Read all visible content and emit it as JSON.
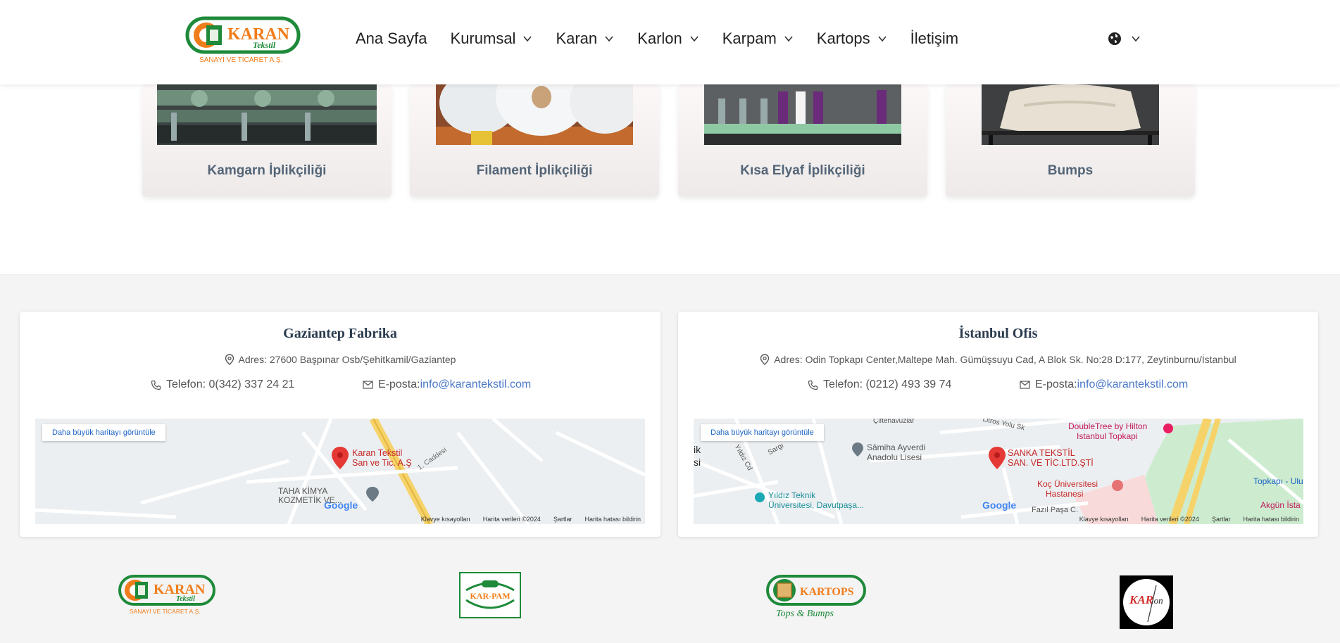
{
  "header": {
    "logo": {
      "name": "KARAN",
      "sub": "Tekstil",
      "tagline": "SANAYİ VE TİCARET A.Ş."
    },
    "nav": [
      {
        "label": "Ana Sayfa",
        "has_dropdown": false
      },
      {
        "label": "Kurumsal",
        "has_dropdown": true
      },
      {
        "label": "Karan",
        "has_dropdown": true
      },
      {
        "label": "Karlon",
        "has_dropdown": true
      },
      {
        "label": "Karpam",
        "has_dropdown": true
      },
      {
        "label": "Kartops",
        "has_dropdown": true
      },
      {
        "label": "İletişim",
        "has_dropdown": false
      }
    ],
    "language_icon": "globe-icon"
  },
  "products": [
    {
      "title": "Kamgarn İplikçiliği"
    },
    {
      "title": "Filament İplikçiliği"
    },
    {
      "title": "Kısa Elyaf İplikçiliği"
    },
    {
      "title": "Bumps"
    }
  ],
  "offices": [
    {
      "title": "Gaziantep Fabrika",
      "address": "Adres: 27600 Başpınar Osb/Şehitkamil/Gaziantep",
      "phone": "Telefon: 0(342) 337 24 21",
      "email_label": "E-posta:",
      "email": "info@karantekstil.com",
      "map": {
        "button": "Daha büyük haritayı görüntüle",
        "pin_label_1": "Karan Tekstil",
        "pin_label_2": "San ve Tic. A.Ş",
        "poi_1": "TAHA KİMYA",
        "poi_2": "KOZMETİK VE...",
        "street": "1. Caddesi",
        "footer": [
          "Klavye kısayolları",
          "Harita verileri ©2024",
          "Şartlar",
          "Harita hatası bildirin"
        ],
        "brand": "Google"
      }
    },
    {
      "title": "İstanbul Ofis",
      "address": "Adres: Odin Topkapı Center,Maltepe Mah. Gümüşsuyu Cad, A Blok Sk. No:28 D:177, Zeytinburnu/İstanbul",
      "phone": "Telefon: (0212) 493 39 74",
      "email_label": "E-posta:",
      "email": "info@karantekstil.com",
      "map": {
        "button": "Daha büyük haritayı görüntüle",
        "pin_label_1": "SANKA TEKSTİL",
        "pin_label_2": "SAN. VE TİC.LTD.ŞTİ",
        "poi_1": "Sâmiha Ayverdi",
        "poi_2": "Anadolu Lisesi",
        "poi_3": "Yıldız Teknik",
        "poi_4": "Üniversitesi, Davutpaşa...",
        "poi_5": "Koç Üniversitesi",
        "poi_6": "Hastanesi",
        "poi_7": "DoubleTree by Hilton",
        "poi_8": "Istanbul Topkapi",
        "poi_9": "Topkapı - Ulu",
        "poi_10": "Akgün İsta",
        "street_1": "Çiftehavuzlar",
        "street_2": "Litros Yolu Sk",
        "street_3": "Fazıl Paşa C.",
        "street_4": "Sargı",
        "street_5": "Yıldız Cd",
        "edge_1": "ik",
        "edge_2": "si",
        "footer": [
          "Klavye kısayolları",
          "Harita verileri ©2024",
          "Şartlar",
          "Harita hatası bildirin"
        ],
        "brand": "Google"
      }
    }
  ],
  "brands": [
    {
      "name": "KARAN",
      "sub": "Tekstil",
      "tagline": "SANAYİ VE TİCARET A.Ş."
    },
    {
      "name": "KAR-PAM"
    },
    {
      "name": "KARTOPS",
      "sub": "Tops & Bumps"
    },
    {
      "name": "KAR",
      "sub": "lon"
    }
  ],
  "colors": {
    "green": "#1e8a3a",
    "orange": "#f07d1b",
    "card_title": "#546577",
    "link": "#4a78c8"
  }
}
